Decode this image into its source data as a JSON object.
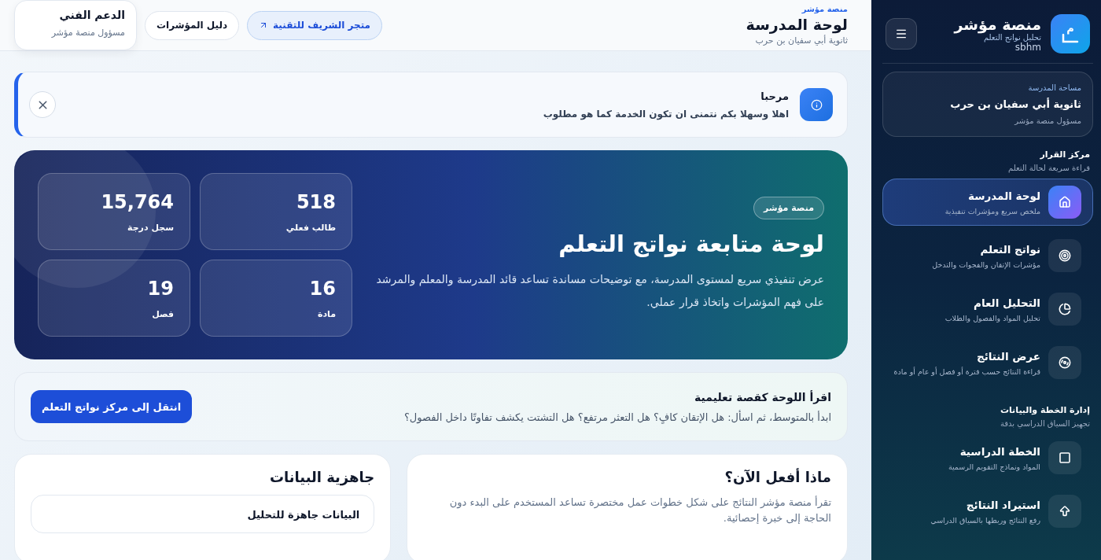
{
  "sidebar": {
    "brand": {
      "title": "منصة مؤشر",
      "subtitle": "تحليل نواتج التعلم",
      "user": "sbhm",
      "logo": "م"
    },
    "workspace": {
      "label": "مساحة المدرسة",
      "school": "ثانوية أبي سفيان بن حرب",
      "role": "مسؤول منصة مؤشر"
    },
    "sections": [
      {
        "title": "مركز القرار",
        "subtitle": "قراءة سريعة لحالة التعلم",
        "items": [
          {
            "label": "لوحة المدرسة",
            "description": "ملخص سريع ومؤشرات تنفيذية",
            "selected": true
          },
          {
            "label": "نواتج التعلم",
            "description": "مؤشرات الإتقان والفجوات والتدخل",
            "selected": false
          },
          {
            "label": "التحليل العام",
            "description": "تحليل المواد والفصول والطلاب",
            "selected": false
          },
          {
            "label": "عرض النتائج",
            "description": "قراءة النتائج حسب فترة أو فصل أو عام أو مادة",
            "selected": false
          }
        ]
      },
      {
        "title": "إدارة الخطة والبيانات",
        "subtitle": "تجهيز السياق الدراسي بدقة",
        "items": [
          {
            "label": "الخطة الدراسية",
            "description": "المواد ونماذج التقويم الرسمية",
            "selected": false
          },
          {
            "label": "استيراد النتائج",
            "description": "رفع النتائج وربطها بالسياق الدراسي",
            "selected": false
          }
        ]
      }
    ]
  },
  "header": {
    "eyebrow": "منصة مؤشر",
    "title": "لوحة المدرسة",
    "subtitle": "ثانوية أبي سفيان بن حرب",
    "buttons": [
      {
        "label": "متجر الشريف للتقنية",
        "kind": "link"
      },
      {
        "label": "دليل المؤشرات",
        "kind": "plain"
      }
    ],
    "support": {
      "title": "الدعم الفني",
      "subtitle": "مسؤول منصة مؤشر"
    }
  },
  "notice": {
    "title": "مرحبا",
    "message": "اهلا وسهلا بكم نتمنى ان تكون الخدمة كما هو مطلوب"
  },
  "hero": {
    "badge": "منصة مؤشر",
    "title": "لوحة متابعة نواتج التعلم",
    "description": "عرض تنفيذي سريع لمستوى المدرسة، مع توضيحات مساندة تساعد قائد المدرسة والمعلم والمرشد على فهم المؤشرات واتخاذ قرار عملي.",
    "stats": [
      {
        "value": "518",
        "label": "طالب فعلي"
      },
      {
        "value": "15,764",
        "label": "سجل درجة"
      },
      {
        "value": "16",
        "label": "مادة"
      },
      {
        "value": "19",
        "label": "فصل"
      }
    ]
  },
  "lesson": {
    "title": "اقرأ اللوحة كقصة تعليمية",
    "text": "ابدأ بالمتوسط، ثم اسأل: هل الإتقان كافٍ؟ هل التعثر مرتفع؟ هل التشتت يكشف تفاوتًا داخل الفصول؟",
    "button": "انتقل إلى مركز نواتج التعلم"
  },
  "next": {
    "title": "ماذا أفعل الآن؟",
    "text": "تقرأ منصة مؤشر النتائج على شكل خطوات عمل مختصرة تساعد المستخدم على البدء دون الحاجة إلى خبرة إحصائية."
  },
  "readiness": {
    "title": "جاهزية البيانات",
    "items": [
      {
        "title": "البيانات جاهزة للتحليل"
      }
    ]
  }
}
